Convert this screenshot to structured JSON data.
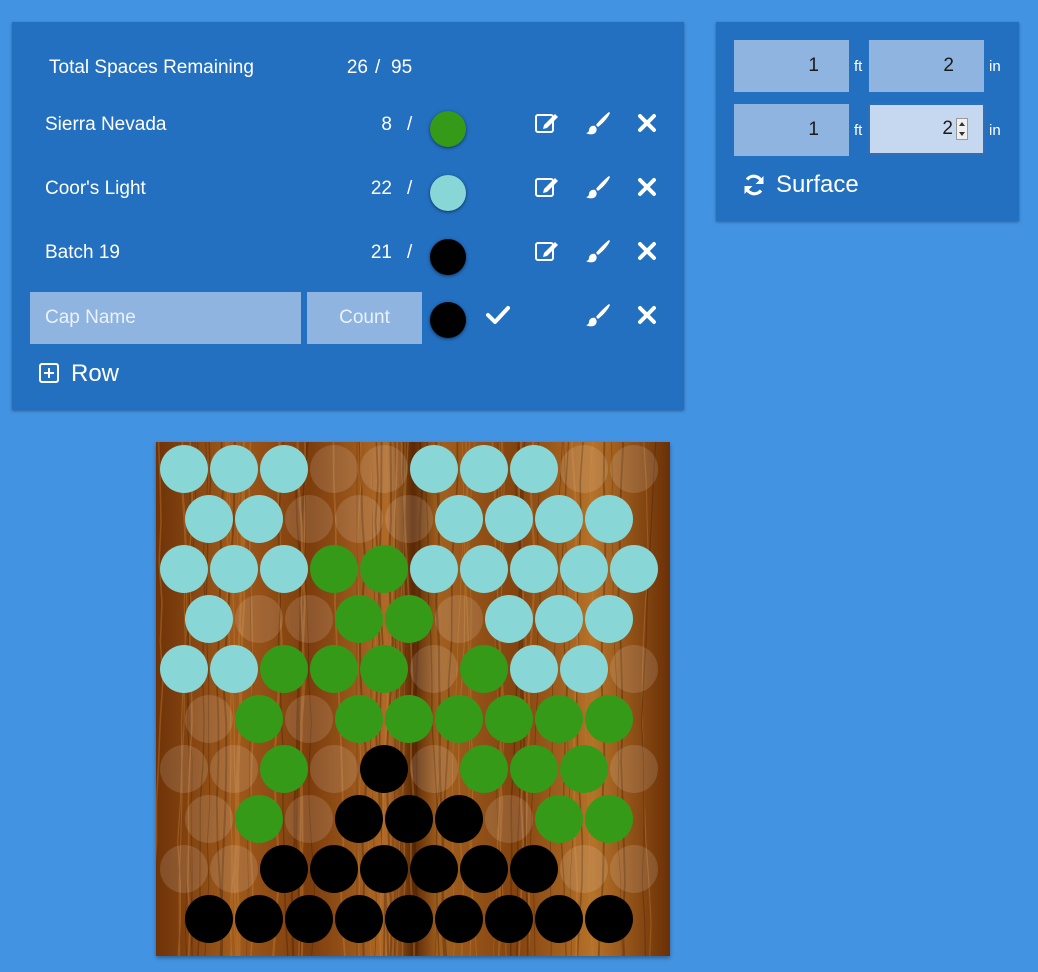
{
  "summary": {
    "label": "Total Spaces Remaining",
    "remaining": "26",
    "separator": "/",
    "total": "95"
  },
  "caps": [
    {
      "name": "Sierra Nevada",
      "count": "8",
      "separator": "/",
      "color": "#369a19"
    },
    {
      "name": "Coor's Light",
      "count": "22",
      "separator": "/",
      "color": "#88d7d6"
    },
    {
      "name": "Batch 19",
      "count": "21",
      "separator": "/",
      "color": "#000000"
    }
  ],
  "new_cap": {
    "name_placeholder": "Cap Name",
    "count_placeholder": "Count",
    "color": "#000000"
  },
  "add_row_label": "Row",
  "surface": {
    "width": {
      "ft": "1",
      "in": "2"
    },
    "height": {
      "ft": "1",
      "in": "2"
    },
    "unit_ft": "ft",
    "unit_in": "in",
    "button_label": "Surface"
  },
  "colors": {
    "green": "#369a19",
    "light": "#88d7d6",
    "black": "#000000",
    "empty": "rgba(255,255,255,0.13)"
  },
  "board": {
    "legend": {
      "G": "green",
      "L": "light",
      "B": "black",
      "E": "empty"
    },
    "rows": [
      [
        "L",
        "L",
        "L",
        "E",
        "E",
        "L",
        "L",
        "L",
        "E",
        "E"
      ],
      [
        "L",
        "L",
        "E",
        "E",
        "E",
        "L",
        "L",
        "L",
        "L"
      ],
      [
        "L",
        "L",
        "L",
        "G",
        "G",
        "L",
        "L",
        "L",
        "L",
        "L"
      ],
      [
        "L",
        "E",
        "E",
        "G",
        "G",
        "E",
        "L",
        "L",
        "L"
      ],
      [
        "L",
        "L",
        "G",
        "G",
        "G",
        "E",
        "G",
        "L",
        "L",
        "E"
      ],
      [
        "E",
        "G",
        "E",
        "G",
        "G",
        "G",
        "G",
        "G",
        "G"
      ],
      [
        "E",
        "E",
        "G",
        "E",
        "B",
        "E",
        "G",
        "G",
        "G",
        "E"
      ],
      [
        "E",
        "G",
        "E",
        "B",
        "B",
        "B",
        "E",
        "G",
        "G"
      ],
      [
        "E",
        "E",
        "B",
        "B",
        "B",
        "B",
        "B",
        "B",
        "E",
        "E"
      ],
      [
        "B",
        "B",
        "B",
        "B",
        "B",
        "B",
        "B",
        "B",
        "B"
      ]
    ]
  }
}
